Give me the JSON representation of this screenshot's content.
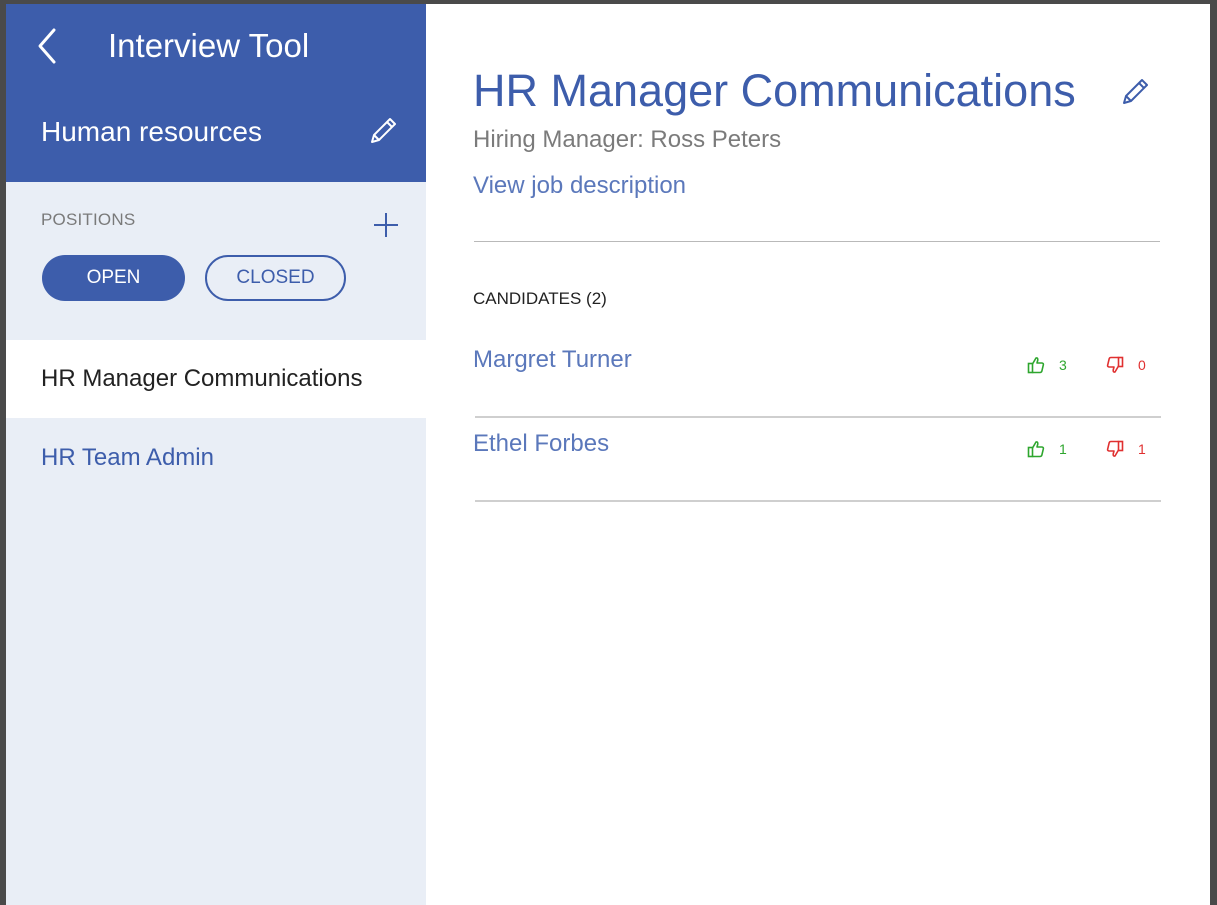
{
  "app": {
    "title": "Interview Tool"
  },
  "department": {
    "name": "Human resources"
  },
  "positions": {
    "label": "POSITIONS",
    "filters": {
      "open": "OPEN",
      "closed": "CLOSED"
    },
    "items": [
      {
        "label": "HR Manager Communications"
      },
      {
        "label": "HR Team Admin"
      }
    ]
  },
  "job": {
    "title": "HR Manager Communications",
    "hiring_manager": "Hiring Manager: Ross Peters",
    "view_description": "View job description"
  },
  "candidates": {
    "header": "CANDIDATES (2)",
    "items": [
      {
        "name": "Margret Turner",
        "up": "3",
        "down": "0"
      },
      {
        "name": "Ethel Forbes",
        "up": "1",
        "down": "1"
      }
    ]
  },
  "colors": {
    "accent": "#3d5dab",
    "sidebar_bg": "#e9eef6",
    "upvote": "#2ea62e",
    "downvote": "#e03030"
  },
  "icons": [
    "back-chevron-icon",
    "pencil-icon",
    "plus-icon",
    "thumbs-up-icon",
    "thumbs-down-icon"
  ]
}
